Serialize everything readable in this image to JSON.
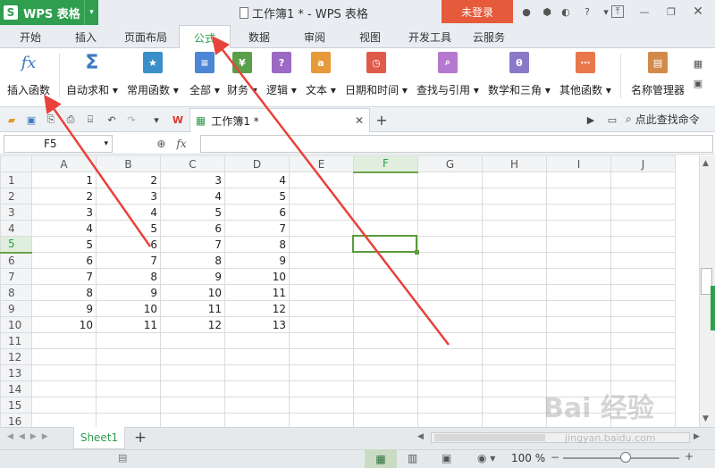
{
  "app": {
    "name": "WPS 表格",
    "window_title": "工作簿1 * - WPS 表格",
    "login": "未登录"
  },
  "menu": {
    "tabs": [
      "开始",
      "插入",
      "页面布局",
      "公式",
      "数据",
      "审阅",
      "视图",
      "开发工具",
      "云服务"
    ],
    "active": "公式"
  },
  "ribbon": {
    "insert_function": "插入函数",
    "autosum": "自动求和",
    "common": "常用函数",
    "all": "全部",
    "finance": "财务",
    "logic": "逻辑",
    "text": "文本",
    "datetime": "日期和时间",
    "lookup": "查找与引用",
    "math": "数学和三角",
    "other": "其他函数",
    "name_manager": "名称管理器"
  },
  "colors": {
    "brand": "#2f9e4f",
    "login": "#e45a3a",
    "arrow": "#e8423a",
    "selection": "#5c9a3a"
  },
  "doc_tab": {
    "title": "工作簿1 *"
  },
  "search": {
    "label": "点此查找命令"
  },
  "formula_bar": {
    "name_box": "F5",
    "fx": "fx"
  },
  "grid": {
    "columns": [
      "A",
      "B",
      "C",
      "D",
      "E",
      "F",
      "G",
      "H",
      "I",
      "J"
    ],
    "rows": [
      [
        "1",
        "1",
        "2",
        "3",
        "4"
      ],
      [
        "2",
        "2",
        "3",
        "4",
        "5"
      ],
      [
        "3",
        "3",
        "4",
        "5",
        "6"
      ],
      [
        "4",
        "4",
        "5",
        "6",
        "7"
      ],
      [
        "5",
        "5",
        "6",
        "7",
        "8"
      ],
      [
        "6",
        "6",
        "7",
        "8",
        "9"
      ],
      [
        "7",
        "7",
        "8",
        "9",
        "10"
      ],
      [
        "8",
        "8",
        "9",
        "10",
        "11"
      ],
      [
        "9",
        "9",
        "10",
        "11",
        "12"
      ],
      [
        "10",
        "10",
        "11",
        "12",
        "13"
      ],
      [
        "11"
      ],
      [
        "12"
      ],
      [
        "13"
      ],
      [
        "14"
      ],
      [
        "15"
      ],
      [
        "16"
      ]
    ],
    "selected_cell": "F5"
  },
  "sheets": {
    "active": "Sheet1",
    "add": "+"
  },
  "status": {
    "zoom": "100 %"
  },
  "watermark": {
    "logo": "Bai 经验",
    "url": "jingyan.baidu.com"
  }
}
